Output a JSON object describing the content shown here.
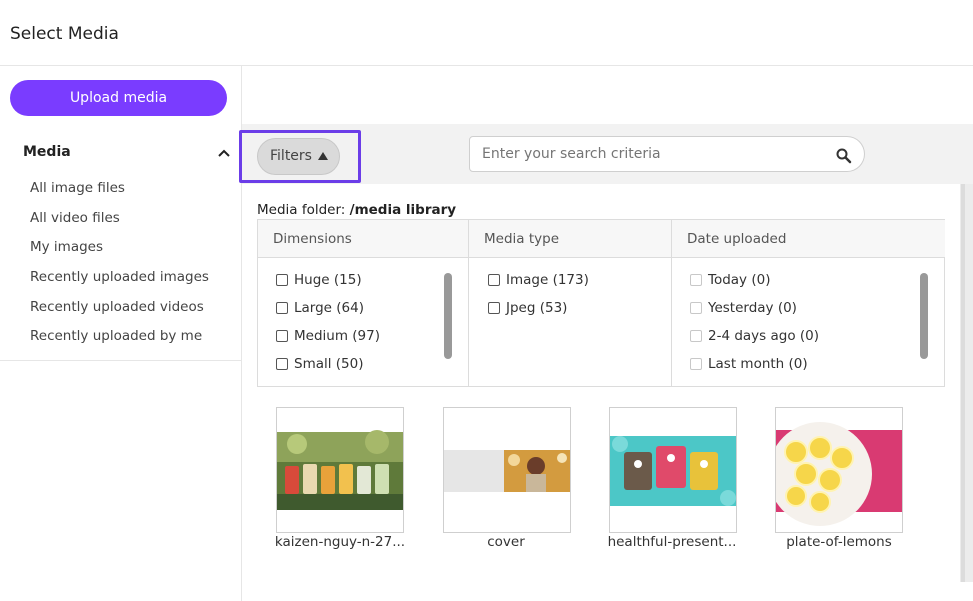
{
  "header": {
    "title": "Select Media"
  },
  "sidebar": {
    "upload_label": "Upload media",
    "section_title": "Media",
    "items": [
      {
        "label": "All image files"
      },
      {
        "label": "All video files"
      },
      {
        "label": "My images"
      },
      {
        "label": "Recently uploaded images"
      },
      {
        "label": "Recently uploaded videos"
      },
      {
        "label": "Recently uploaded by me"
      }
    ]
  },
  "toolbar": {
    "filters_label": "Filters",
    "search_placeholder": "Enter your search criteria"
  },
  "folder": {
    "prefix": "Media folder: ",
    "path": "/media library"
  },
  "filters": {
    "dimensions": {
      "title": "Dimensions",
      "options": [
        "Huge (15)",
        "Large (64)",
        "Medium (97)",
        "Small (50)"
      ]
    },
    "media_type": {
      "title": "Media type",
      "options": [
        "Image (173)",
        "Jpeg (53)"
      ]
    },
    "date_uploaded": {
      "title": "Date uploaded",
      "options": [
        "Today (0)",
        "Yesterday (0)",
        "2-4 days ago (0)",
        "Last month (0)"
      ]
    }
  },
  "media_items": [
    {
      "label": "kaizen-nguy-n-27..."
    },
    {
      "label": "cover"
    },
    {
      "label": "healthful-present..."
    },
    {
      "label": "plate-of-lemons"
    }
  ],
  "colors": {
    "accent": "#7a3cff",
    "highlight_outline": "#6b3de8"
  }
}
